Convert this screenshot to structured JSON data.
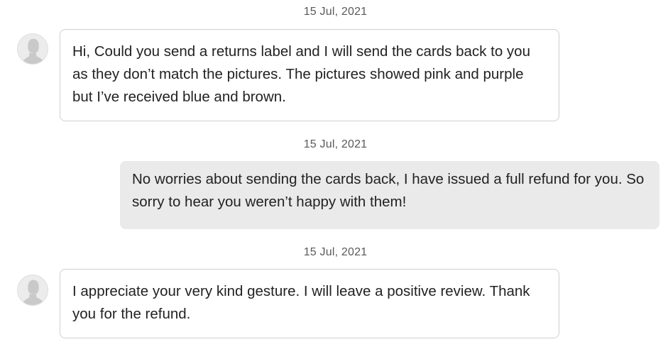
{
  "messages": [
    {
      "date": "15 Jul, 2021",
      "sender": "buyer",
      "avatar_icon": "default-user-avatar-icon",
      "text": "Hi, Could you send a returns label and I will send the cards back to you as they don’t match the pictures. The pictures showed pink and purple but I’ve received blue and brown."
    },
    {
      "date": "15 Jul, 2021",
      "sender": "seller",
      "text": "No worries about sending the cards back, I have issued a full refund for you. So sorry to hear you weren’t happy with them!"
    },
    {
      "date": "15 Jul, 2021",
      "sender": "buyer",
      "avatar_icon": "default-user-avatar-icon",
      "text": "I appreciate your very kind gesture. I will leave a positive review. Thank you for the refund."
    }
  ],
  "colors": {
    "incoming_bubble_bg": "#ffffff",
    "incoming_bubble_border": "#cfcfcf",
    "outgoing_bubble_bg": "#eaeaea",
    "date_text": "#595959",
    "message_text": "#222222"
  }
}
